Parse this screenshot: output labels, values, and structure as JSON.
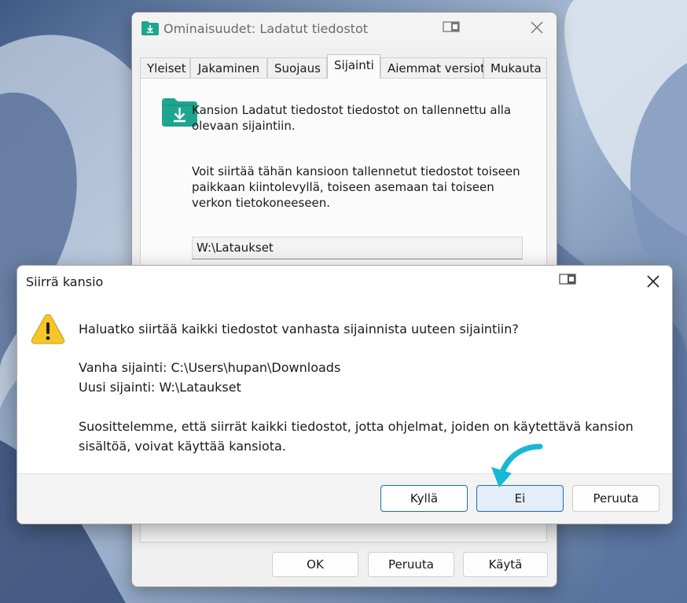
{
  "properties_window": {
    "title": "Ominaisuudet: Ladatut tiedostot",
    "tabs": [
      "Yleiset",
      "Jakaminen",
      "Suojaus",
      "Sijainti",
      "Aiemmat versiot",
      "Mukauta"
    ],
    "active_tab": "Sijainti",
    "description_1": "Kansion Ladatut tiedostot tiedostot on tallennettu alla olevaan sijaintiin.",
    "description_2": "Voit siirtää tähän kansioon tallennetut tiedostot toiseen paikkaan kiintolevyllä, toiseen asemaan tai toiseen verkon tietokoneeseen.",
    "path_value": "W:\\Lataukset",
    "buttons": {
      "ok": "OK",
      "cancel": "Peruuta",
      "apply": "Käytä"
    }
  },
  "move_dialog": {
    "title": "Siirrä kansio",
    "question": "Haluatko siirtää kaikki tiedostot vanhasta sijainnista uuteen sijaintiin?",
    "old_location": "Vanha sijainti: C:\\Users\\hupan\\Downloads",
    "new_location": "Uusi sijainti: W:\\Lataukset",
    "recommendation_line1": "Suosittelemme, että siirrät kaikki tiedostot, jotta ohjelmat, joiden on käytettävä kansion",
    "recommendation_line2": "sisältöä, voivat käyttää kansiota.",
    "buttons": {
      "yes": "Kyllä",
      "no": "Ei",
      "cancel": "Peruuta"
    }
  },
  "icons": {
    "folder": "download-folder-icon",
    "warning": "warning-icon",
    "close": "close-icon",
    "snap": "snap-layout-icon",
    "annotation": "pointer-arrow-annotation"
  },
  "colors": {
    "folder_teal": "#1fa58e",
    "warning_yellow": "#f7c629",
    "focus_blue": "#1a6db7",
    "annotation_cyan": "#17b8d6"
  }
}
